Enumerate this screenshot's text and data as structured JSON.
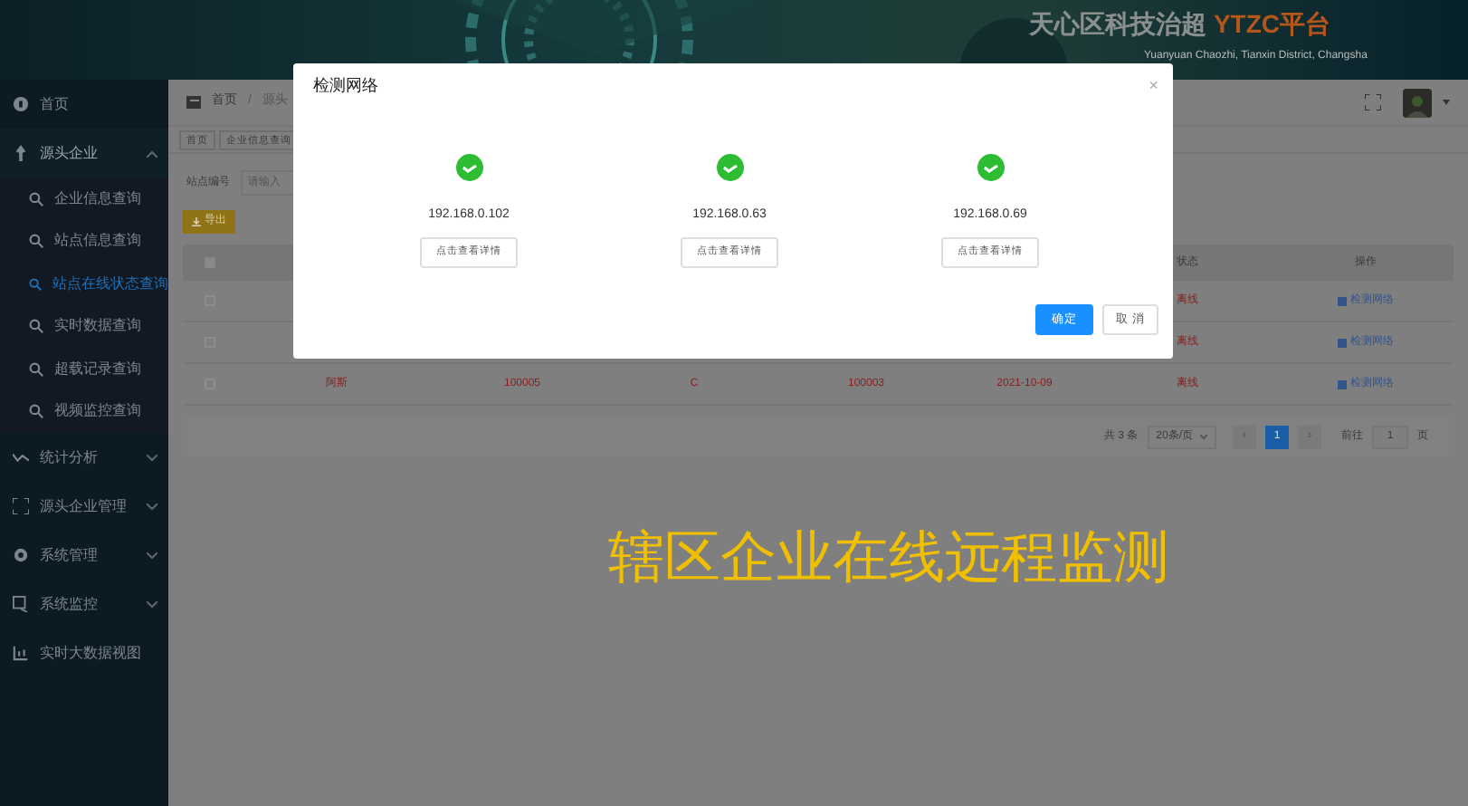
{
  "header": {
    "title": "天心区科技治超",
    "title_accent": "YTZC平台",
    "subtitle": "Yuanyuan Chaozhi, Tianxin District, Changsha"
  },
  "sidebar": {
    "items": [
      {
        "label": "首页",
        "kind": "link"
      },
      {
        "label": "源头企业",
        "kind": "group",
        "expanded": true,
        "children": [
          {
            "label": "企业信息查询",
            "selected": false
          },
          {
            "label": "站点信息查询",
            "selected": false
          },
          {
            "label": "站点在线状态查询",
            "selected": true
          },
          {
            "label": "实时数据查询",
            "selected": false
          },
          {
            "label": "超载记录查询",
            "selected": false
          },
          {
            "label": "视频监控查询",
            "selected": false
          }
        ]
      },
      {
        "label": "统计分析",
        "kind": "group",
        "expanded": false
      },
      {
        "label": "源头企业管理",
        "kind": "group",
        "expanded": false
      },
      {
        "label": "系统管理",
        "kind": "group",
        "expanded": false
      },
      {
        "label": "系统监控",
        "kind": "group",
        "expanded": false
      },
      {
        "label": "实时大数据视图",
        "kind": "link"
      }
    ]
  },
  "breadcrumb": [
    "首页",
    "/",
    "源头"
  ],
  "tabs": [
    {
      "label": "首页",
      "selected": false
    },
    {
      "label": "企业信息查询",
      "selected": false
    }
  ],
  "filter": {
    "label": "站点编号",
    "placeholder": "请输入"
  },
  "export_button": "导出",
  "table": {
    "select_all_checked": false,
    "columns": {
      "status": "状态",
      "action": "操作"
    },
    "rows": [
      {
        "checked": false,
        "status": "离线",
        "action": "检测网络"
      },
      {
        "checked": false,
        "status": "离线",
        "action": "检测网络"
      },
      {
        "checked": false,
        "name": "阿斯",
        "code": "100005",
        "grade": "C",
        "station": "100003",
        "date": "2021-10-09",
        "status": "离线",
        "action": "检测网络"
      }
    ]
  },
  "pagination": {
    "total": "共 3 条",
    "page_size": "20条/页",
    "prev": "‹",
    "pages": [
      {
        "label": "1",
        "selected": true
      }
    ],
    "next": "›",
    "goto_label": "前往",
    "goto_value": "1",
    "goto_suffix": "页"
  },
  "caption": "辖区企业在线远程监测",
  "dialog": {
    "title": "检测网络",
    "close": "×",
    "hosts": [
      {
        "ip": "192.168.0.102",
        "ok": true,
        "button": "点击查看详情"
      },
      {
        "ip": "192.168.0.63",
        "ok": true,
        "button": "点击查看详情"
      },
      {
        "ip": "192.168.0.69",
        "ok": true,
        "button": "点击查看详情"
      }
    ],
    "confirm": "确定",
    "cancel": "取 消"
  }
}
